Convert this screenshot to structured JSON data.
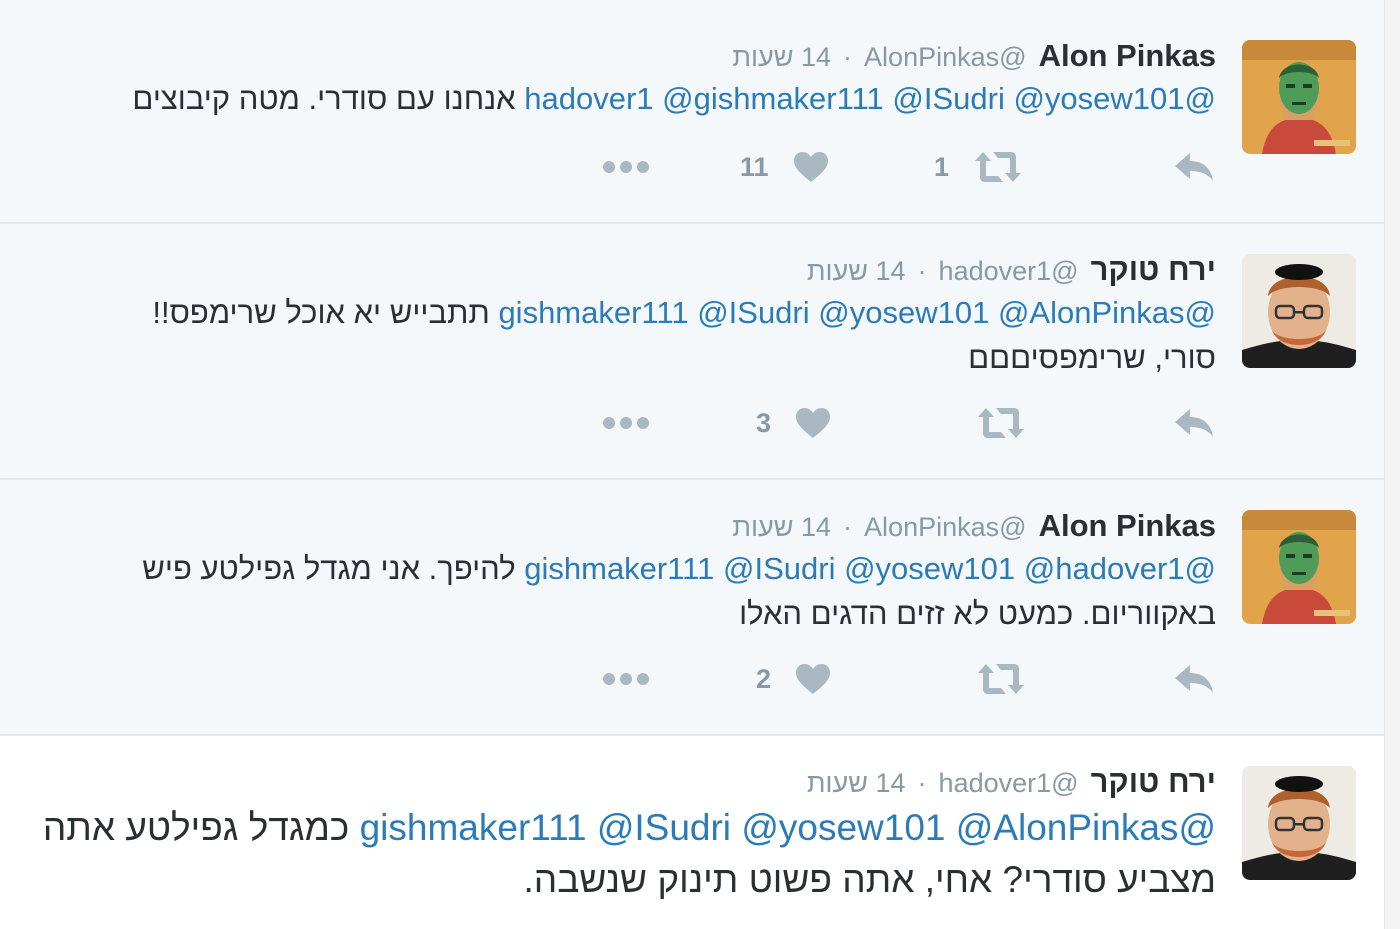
{
  "colors": {
    "mention": "#2b7bb9",
    "meta": "#8899a6",
    "text": "#292f33",
    "action_icon": "#aab8c2",
    "read_bg": "#f5f8fa",
    "separator": "#e1e8ed"
  },
  "tweets": [
    {
      "fullname": "Alon Pinkas",
      "username": "@AlonPinkas",
      "separator": "·",
      "time": "14 שעות",
      "segments": [
        {
          "text": "@hadover1",
          "mention": true
        },
        {
          "text": " ",
          "mention": false
        },
        {
          "text": "@gishmaker111",
          "mention": true
        },
        {
          "text": " ",
          "mention": false
        },
        {
          "text": "@ISudri",
          "mention": true
        },
        {
          "text": " ",
          "mention": false
        },
        {
          "text": "@yosew101",
          "mention": true
        },
        {
          "text": " אנחנו עם סודרי. מטה קיבוצים",
          "mention": false
        }
      ],
      "retweet_count": "1",
      "like_count": "11",
      "avatar_icon": "avatar-icon"
    },
    {
      "fullname": "ירח טוקר",
      "username": "@hadover1",
      "separator": "·",
      "time": "14 שעות",
      "segments": [
        {
          "text": "@gishmaker111",
          "mention": true
        },
        {
          "text": " ",
          "mention": false
        },
        {
          "text": "@ISudri",
          "mention": true
        },
        {
          "text": " ",
          "mention": false
        },
        {
          "text": "@yosew101",
          "mention": true
        },
        {
          "text": " ",
          "mention": false
        },
        {
          "text": "@AlonPinkas",
          "mention": true
        },
        {
          "text": " תתבייש יא אוכל שרימפס!!",
          "mention": false
        },
        {
          "text": "\nסורי, שרימפסיםםם",
          "mention": false
        }
      ],
      "retweet_count": "",
      "like_count": "3",
      "avatar_icon": "avatar-icon"
    },
    {
      "fullname": "Alon Pinkas",
      "username": "@AlonPinkas",
      "separator": "·",
      "time": "14 שעות",
      "segments": [
        {
          "text": "@gishmaker111",
          "mention": true
        },
        {
          "text": " ",
          "mention": false
        },
        {
          "text": "@ISudri",
          "mention": true
        },
        {
          "text": " ",
          "mention": false
        },
        {
          "text": "@yosew101",
          "mention": true
        },
        {
          "text": " ",
          "mention": false
        },
        {
          "text": "@hadover1",
          "mention": true
        },
        {
          "text": " להיפך. אני מגדל גפילטע פיש",
          "mention": false
        },
        {
          "text": "\nבאקווריום. כמעט לא זזים הדגים האלו",
          "mention": false
        }
      ],
      "retweet_count": "",
      "like_count": "2",
      "avatar_icon": "avatar-icon"
    },
    {
      "fullname": "ירח טוקר",
      "username": "@hadover1",
      "separator": "·",
      "time": "14 שעות",
      "segments": [
        {
          "text": "@gishmaker111",
          "mention": true
        },
        {
          "text": " ",
          "mention": false
        },
        {
          "text": "@ISudri",
          "mention": true
        },
        {
          "text": " ",
          "mention": false
        },
        {
          "text": "@yosew101",
          "mention": true
        },
        {
          "text": " ",
          "mention": false
        },
        {
          "text": "@AlonPinkas",
          "mention": true
        },
        {
          "text": " כמגדל גפילטע אתה",
          "mention": false
        },
        {
          "text": "\nמצביע סודרי? אחי, אתה פשוט תינוק שנשבה.",
          "mention": false
        }
      ],
      "retweet_count": "",
      "like_count": "",
      "avatar_icon": "avatar-icon"
    }
  ]
}
